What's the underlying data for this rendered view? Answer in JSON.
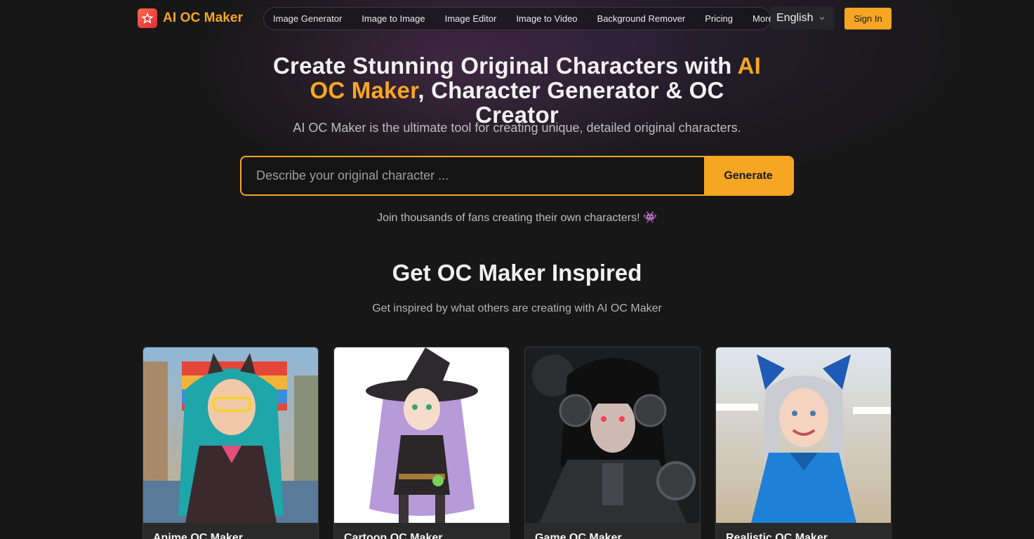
{
  "header": {
    "logo_text": "AI OC Maker",
    "nav": [
      {
        "label": "Image Generator"
      },
      {
        "label": "Image to Image"
      },
      {
        "label": "Image Editor"
      },
      {
        "label": "Image to Video"
      },
      {
        "label": "Background Remover"
      },
      {
        "label": "Pricing"
      },
      {
        "label": "More"
      }
    ],
    "language": "English",
    "sign_in": "Sign In"
  },
  "hero": {
    "title_part1": "Create Stunning Original Characters with ",
    "title_accent": "AI OC Maker",
    "title_part2": ", Character Generator & OC Creator",
    "subtitle": "AI OC Maker is the ultimate tool for creating unique, detailed original characters.",
    "input_placeholder": "Describe your original character ...",
    "generate_label": "Generate",
    "join_text": "Join thousands of fans creating their own characters! 👾"
  },
  "inspired": {
    "title": "Get OC Maker Inspired",
    "subtitle": "Get inspired by what others are creating with AI OC Maker",
    "cards": [
      {
        "label": "Anime OC Maker"
      },
      {
        "label": "Cartoon OC Maker"
      },
      {
        "label": "Game OC Maker"
      },
      {
        "label": "Realistic OC Maker"
      }
    ]
  },
  "colors": {
    "accent": "#f5a623",
    "background": "#171717",
    "card": "#2a2a2a"
  }
}
